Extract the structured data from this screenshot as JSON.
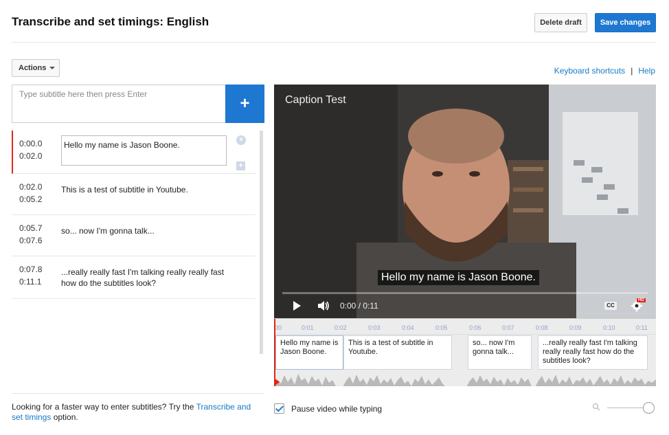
{
  "header": {
    "title": "Transcribe and set timings: English",
    "delete_draft_label": "Delete draft",
    "save_changes_label": "Save changes"
  },
  "toolbar": {
    "actions_label": "Actions",
    "keyboard_shortcuts_label": "Keyboard shortcuts",
    "separator": "|",
    "help_label": "Help"
  },
  "editor": {
    "input_placeholder": "Type subtitle here then press Enter",
    "add_button_label": "+"
  },
  "subtitles": [
    {
      "start": "0:00.0",
      "end": "0:02.0",
      "text": "Hello my name is Jason Boone.",
      "active": true
    },
    {
      "start": "0:02.0",
      "end": "0:05.2",
      "text": "This is a test of subtitle in Youtube."
    },
    {
      "start": "0:05.7",
      "end": "0:07.6",
      "text": "so... now I'm gonna talk..."
    },
    {
      "start": "0:07.8",
      "end": "0:11.1",
      "text": "...really really fast I'm talking really really fast how do the subtitles look?"
    }
  ],
  "tip": {
    "text_before": "Looking for a faster way to enter subtitles? Try the ",
    "link": "Transcribe and set timings",
    "text_after": " option."
  },
  "video": {
    "title": "Caption Test",
    "caption": "Hello my name is Jason Boone.",
    "timecode": "0:00 / 0:11",
    "cc_label": "CC",
    "hd_label": "HD"
  },
  "timeline": {
    "ticks": [
      "00",
      "0:01",
      "0:02",
      "0:03",
      "0:04",
      "0:05",
      "0:06",
      "0:07",
      "0:08",
      "0:09",
      "0:10",
      "0:11"
    ],
    "segments": [
      "Hello my name is Jason Boone.",
      "This is a test of subtitle in Youtube.",
      "so... now I'm gonna talk...",
      "...really really fast I'm talking really really fast how do the subtitles look?"
    ]
  },
  "options": {
    "pause_label": "Pause video while typing",
    "pause_checked": true
  },
  "colors": {
    "accent": "#1e78d1",
    "link": "#167ac6",
    "active_marker": "#e62117"
  }
}
